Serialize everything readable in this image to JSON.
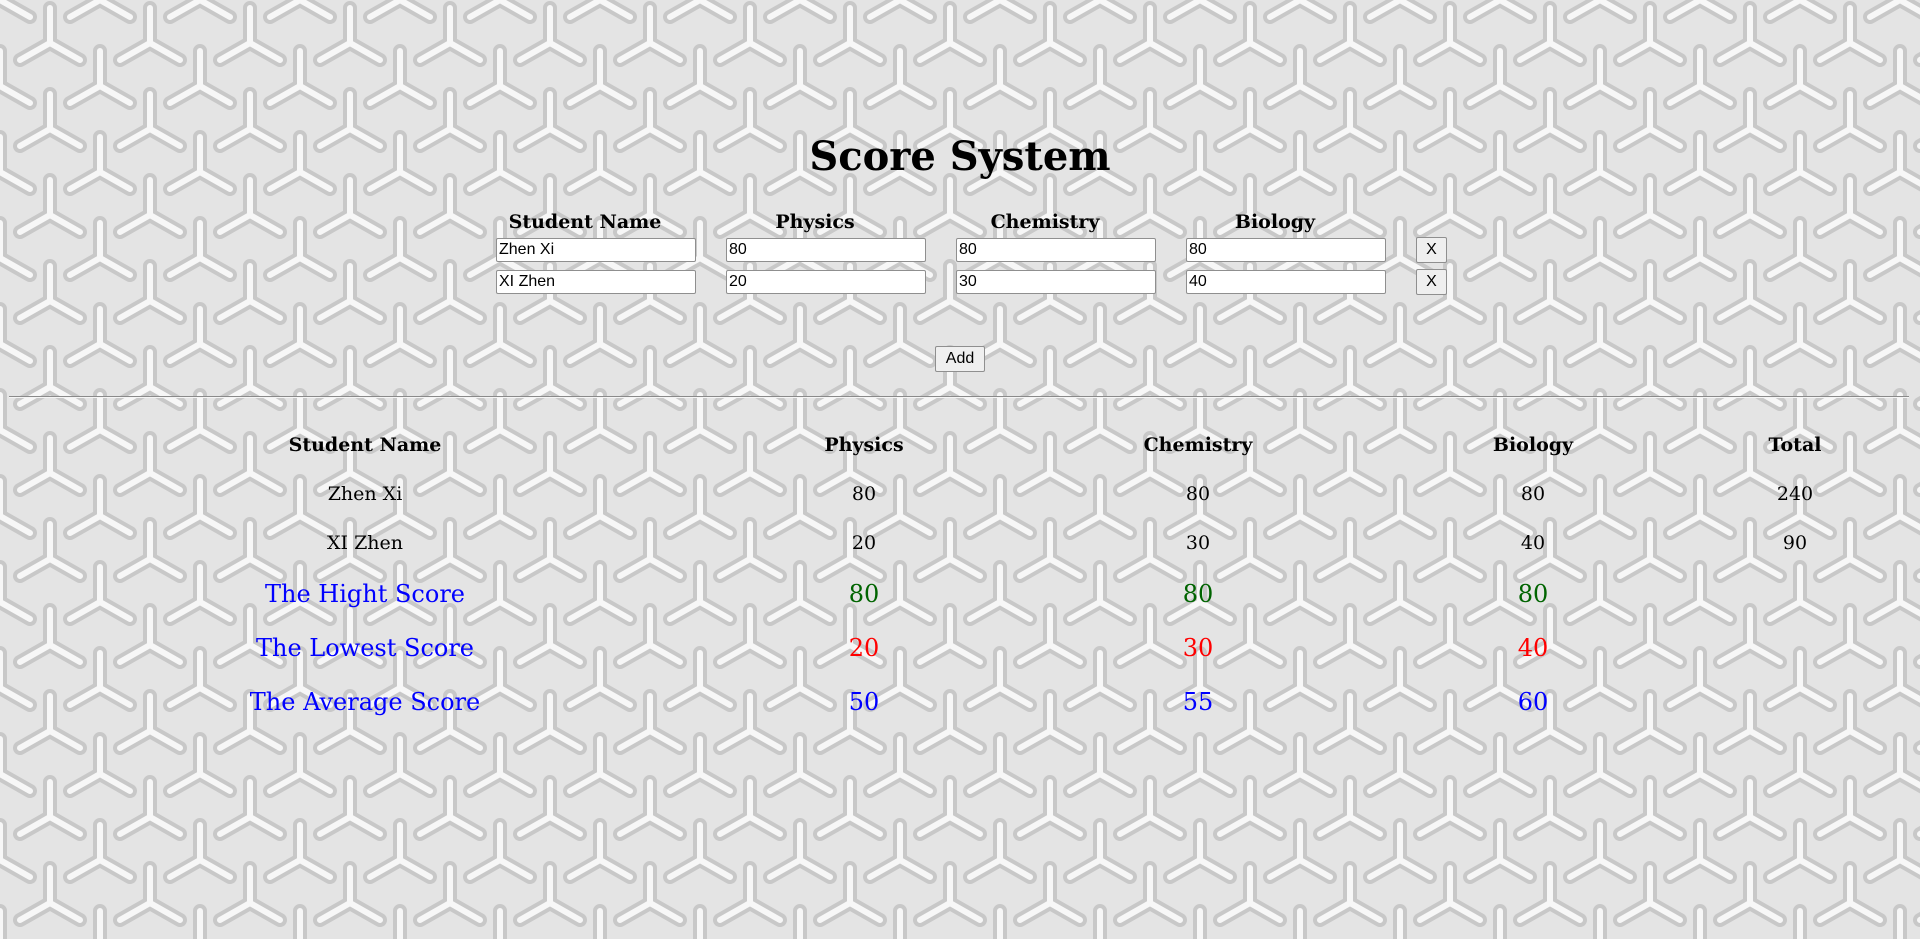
{
  "app": {
    "title": "Score System"
  },
  "form": {
    "headers": {
      "name": "Student Name",
      "physics": "Physics",
      "chemistry": "Chemistry",
      "biology": "Biology"
    },
    "rows": [
      {
        "name": "Zhen Xi",
        "physics": "80",
        "chemistry": "80",
        "biology": "80",
        "delete_label": "X"
      },
      {
        "name": "XI Zhen",
        "physics": "20",
        "chemistry": "30",
        "biology": "40",
        "delete_label": "X"
      }
    ],
    "add_label": "Add"
  },
  "results": {
    "headers": {
      "name": "Student Name",
      "physics": "Physics",
      "chemistry": "Chemistry",
      "biology": "Biology",
      "total": "Total"
    },
    "rows": [
      {
        "name": "Zhen Xi",
        "physics": "80",
        "chemistry": "80",
        "biology": "80",
        "total": "240"
      },
      {
        "name": "XI Zhen",
        "physics": "20",
        "chemistry": "30",
        "biology": "40",
        "total": "90"
      }
    ],
    "highest": {
      "label": "The Hight Score",
      "physics": "80",
      "chemistry": "80",
      "biology": "80"
    },
    "lowest": {
      "label": "The Lowest Score",
      "physics": "20",
      "chemistry": "30",
      "biology": "40"
    },
    "average": {
      "label": "The Average Score",
      "physics": "50",
      "chemistry": "55",
      "biology": "60"
    }
  },
  "colors": {
    "label": "#0000ff",
    "highest": "#006400",
    "lowest": "#ff0000",
    "average": "#0000ff",
    "background": "#e6e6e6"
  }
}
